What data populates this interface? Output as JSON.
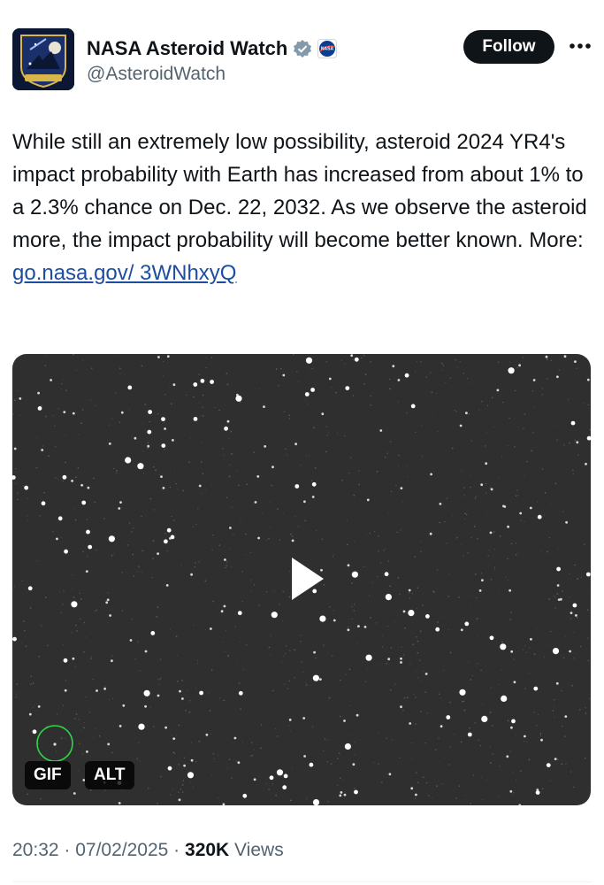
{
  "author": {
    "display_name": "NASA Asteroid Watch",
    "handle": "@AsteroidWatch",
    "avatar_text": "PLANETARY DEFENSE",
    "verified_icon": "verified-gray-check-icon",
    "affiliate_badge_text": "NASA"
  },
  "actions": {
    "follow_label": "Follow",
    "more_icon": "more-dots-icon"
  },
  "tweet": {
    "text": "While still an extremely low possibility, asteroid 2024 YR4's impact probability with Earth has increased from about 1% to a 2.3% chance on Dec. 22, 2032. As we observe the asteroid more, the impact probability will become better known. More: ",
    "link_text": "go.nasa.gov/ 3WNhxyQ"
  },
  "media": {
    "type_badge": "GIF",
    "alt_badge": "ALT",
    "play_icon": "play-icon"
  },
  "meta": {
    "time": "20:32",
    "separator1": " · ",
    "date": "07/02/2025",
    "separator2": " · ",
    "views_count": "320K",
    "views_label": " Views"
  },
  "colors": {
    "text": "#0f1419",
    "secondary": "#536471",
    "link": "#1d4e9e",
    "follow_bg": "#0f1419",
    "media_bg": "#2f2f2f"
  }
}
